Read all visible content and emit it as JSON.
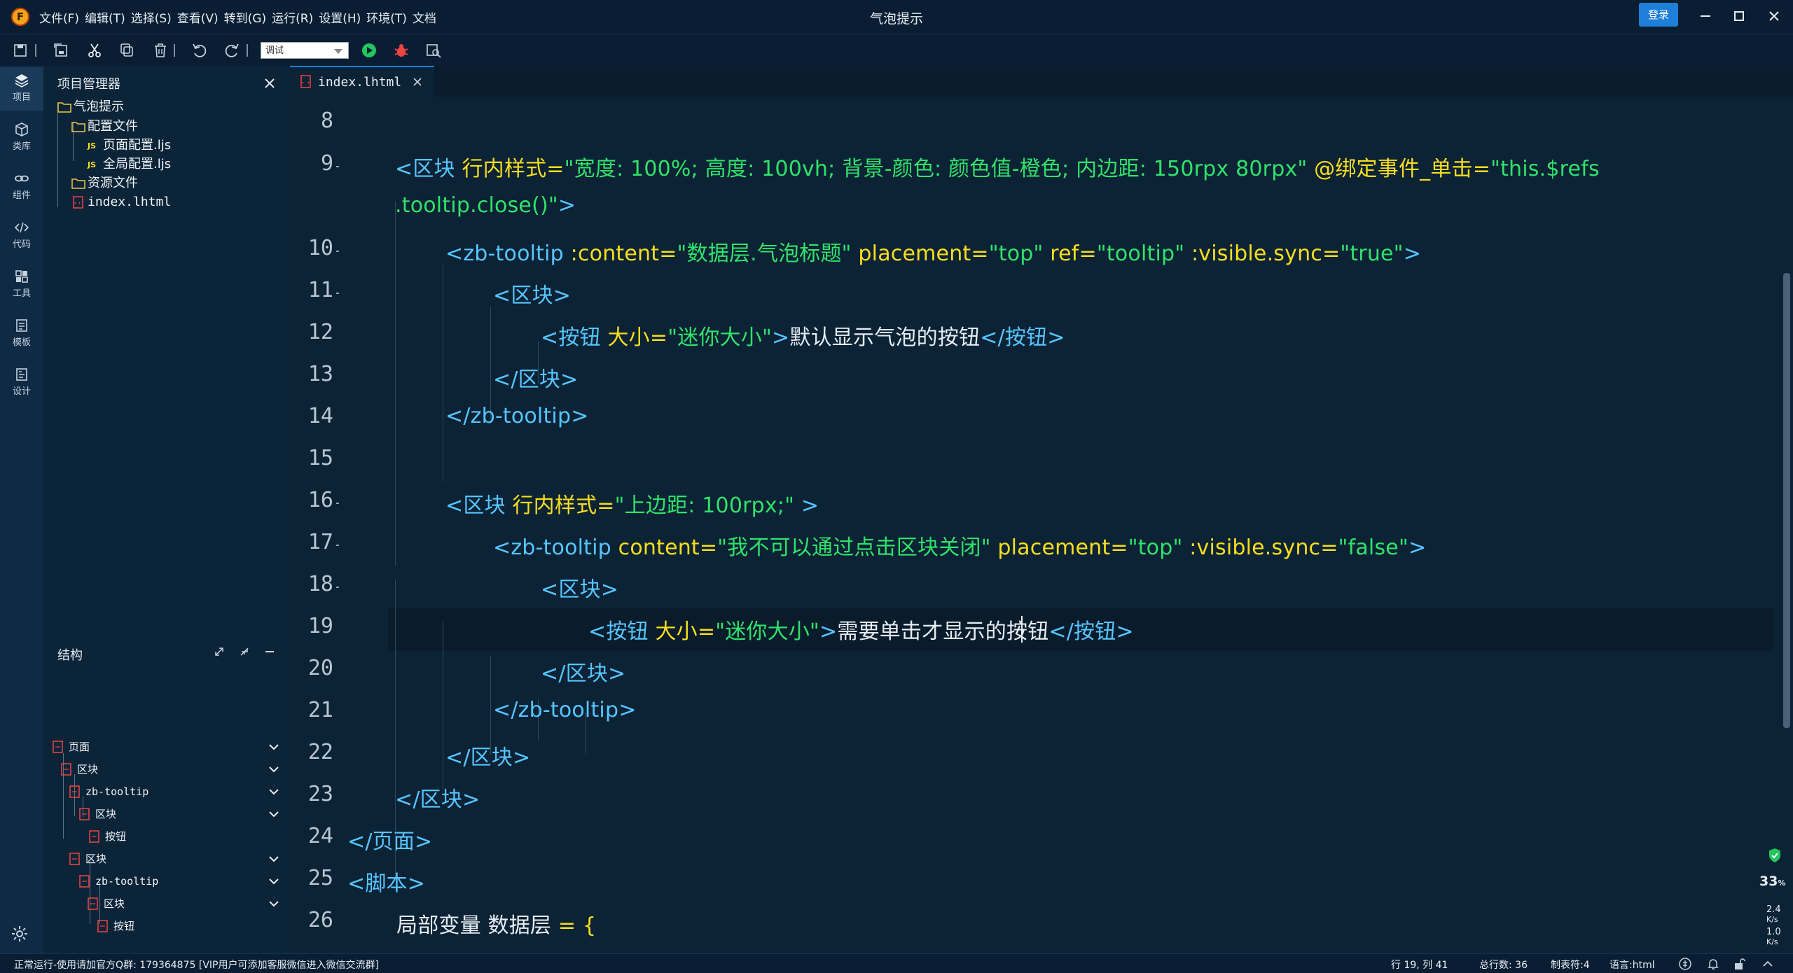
{
  "window": {
    "title": "气泡提示",
    "logo_letter": "F",
    "login_label": "登录",
    "menu": [
      "文件(F)",
      "编辑(T)",
      "选择(S)",
      "查看(V)",
      "转到(G)",
      "运行(R)",
      "设置(H)",
      "环境(T)",
      "文档"
    ]
  },
  "toolbar": {
    "run_config_value": "调试",
    "icons": [
      "save-icon",
      "save-all-icon",
      "cut-icon",
      "copy-icon",
      "delete-icon",
      "undo-icon",
      "redo-icon",
      "run-icon",
      "debug-icon",
      "preview-icon"
    ]
  },
  "activitybar": [
    {
      "label": "项目",
      "icon": "layers-icon"
    },
    {
      "label": "类库",
      "icon": "package-icon"
    },
    {
      "label": "组件",
      "icon": "link-icon"
    },
    {
      "label": "代码",
      "icon": "code-icon"
    },
    {
      "label": "工具",
      "icon": "tools-icon"
    },
    {
      "label": "模板",
      "icon": "template-icon"
    },
    {
      "label": "设计",
      "icon": "design-icon"
    }
  ],
  "explorer": {
    "title": "项目管理器",
    "items": [
      {
        "label": "气泡提示",
        "type": "folder"
      },
      {
        "label": "配置文件",
        "type": "folder"
      },
      {
        "label": "页面配置.ljs",
        "type": "js"
      },
      {
        "label": "全局配置.ljs",
        "type": "js"
      },
      {
        "label": "资源文件",
        "type": "folder"
      },
      {
        "label": "index.lhtml",
        "type": "html"
      }
    ]
  },
  "structure": {
    "title": "结构",
    "items": [
      "页面",
      "区块",
      "zb-tooltip",
      "区块",
      "按钮",
      "区块",
      "zb-tooltip",
      "区块",
      "按钮"
    ]
  },
  "editor": {
    "tab_label": "index.lhtml",
    "line_numbers": [
      "8",
      "9",
      "",
      "10",
      "11",
      "12",
      "13",
      "14",
      "15",
      "16",
      "17",
      "18",
      "19",
      "20",
      "21",
      "22",
      "23",
      "24",
      "25",
      "26"
    ],
    "lines": {
      "l9a": {
        "t1": "<区块 ",
        "a1": "行内样式=",
        "s1": "\"宽度: 100%; 高度: 100vh; 背景-颜色: 颜色值-橙色; 内边距: 150rpx 80rpx\"",
        "a2": " @绑定事件_单击=",
        "s2": "\"this.$refs"
      },
      "l9b": {
        "s1": ".tooltip.close()\"",
        "t1": ">"
      },
      "l10": {
        "t1": "<zb-tooltip ",
        "a1": ":content=",
        "s1": "\"数据层.气泡标题\"",
        "a2": " placement=",
        "s2": "\"top\"",
        "a3": " ref=",
        "s3": "\"tooltip\"",
        "a4": " :visible.sync=",
        "s4": "\"true\"",
        "t2": ">"
      },
      "l11": {
        "t1": "<区块>"
      },
      "l12": {
        "t1": "<按钮 ",
        "a1": "大小=",
        "s1": "\"迷你大小\"",
        "t2": ">",
        "x1": "默认显示气泡的按钮",
        "t3": "</按钮>"
      },
      "l13": {
        "t1": "</区块>"
      },
      "l14": {
        "t1": "</zb-tooltip>"
      },
      "l16": {
        "t1": "<区块 ",
        "a1": "行内样式=",
        "s1": "\"上边距: 100rpx;\"",
        "t2": " >"
      },
      "l17": {
        "t1": "<zb-tooltip ",
        "a1": "content=",
        "s1": "\"我不可以通过点击区块关闭\"",
        "a2": " placement=",
        "s2": "\"top\"",
        "a3": " :visible.sync=",
        "s3": "\"false\"",
        "t2": ">"
      },
      "l18": {
        "t1": "<区块>"
      },
      "l19": {
        "t1": "<按钮 ",
        "a1": "大小=",
        "s1": "\"迷你大小\"",
        "t2": ">",
        "x1": "需要单击才显示的按钮",
        "t3": "</按钮>"
      },
      "l20": {
        "t1": "</区块>"
      },
      "l21": {
        "t1": "</zb-tooltip>"
      },
      "l22": {
        "t1": "</区块>"
      },
      "l23": {
        "t1": "</区块>"
      },
      "l24": {
        "t1": "</页面>"
      },
      "l25": {
        "t1": "<脚本>"
      },
      "l26": {
        "k1": "局部变量 数据层 ",
        "o1": "=",
        "p1": " {"
      }
    }
  },
  "net_widget": {
    "percent": "33",
    "percent_unit": "%",
    "up": "2.4",
    "up_unit": "K/s",
    "down": "1.0",
    "down_unit": "K/s"
  },
  "statusbar": {
    "message": "正常运行-使用请加官方Q群: 179364875 [VIP用户可添加客服微信进入微信交流群]",
    "position": "行 19, 列 41",
    "total_lines": "总行数: 36",
    "tab_size": "制表符:4",
    "language": "语言:html"
  },
  "colors": {
    "accent": "#1e7fd9",
    "tag": "#56c6ff",
    "attr": "#f7df1e",
    "string": "#2fe36a",
    "background": "#0c2235"
  }
}
